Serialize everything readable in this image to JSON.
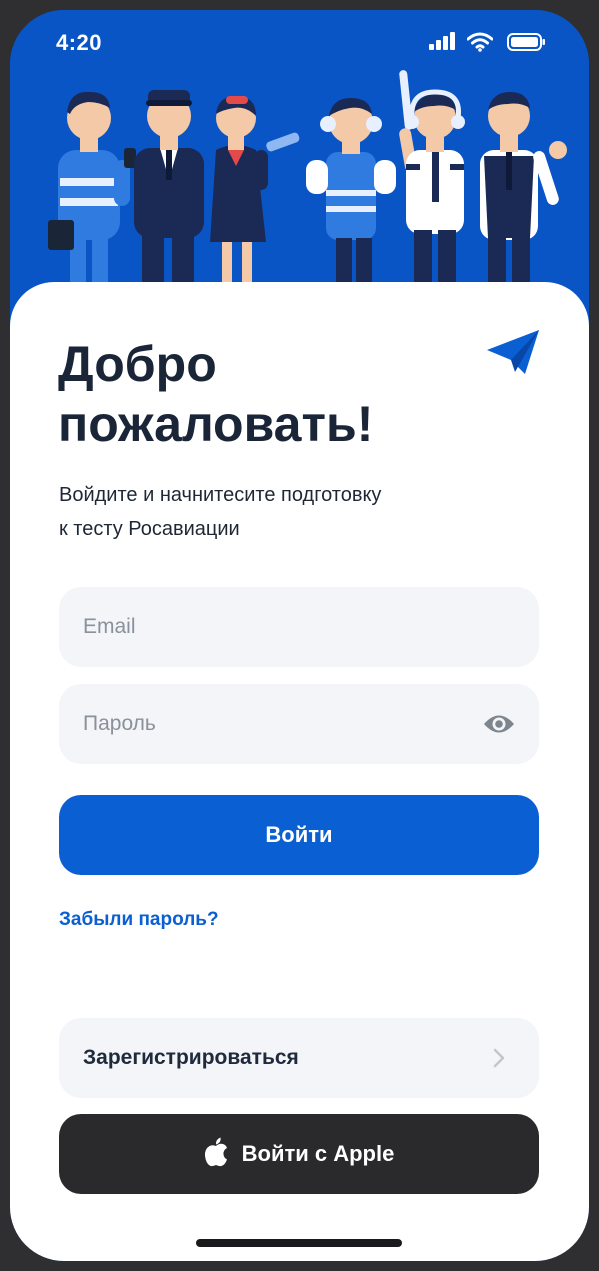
{
  "status_bar": {
    "time": "4:20",
    "icons": [
      "cellular-signal-icon",
      "wifi-icon",
      "battery-icon"
    ]
  },
  "hero": {
    "illustration": "aviation-crew-illustration",
    "background_color": "#0a55c6"
  },
  "login": {
    "title_line1": "Добро",
    "title_line2": "пожаловать!",
    "subtitle_line1": "Войдите и начнитесите подготовку",
    "subtitle_line2": "к тесту Росавиации",
    "email": {
      "placeholder": "Email",
      "value": ""
    },
    "password": {
      "placeholder": "Пароль",
      "value": ""
    },
    "submit_label": "Войти",
    "forgot_label": "Забыли пароль?",
    "register_label": "Зарегистрироваться",
    "apple_label": "Войти с Apple"
  },
  "colors": {
    "brand_blue": "#0a5fd3",
    "title": "#1a2537",
    "field_bg": "#f3f5f8",
    "apple_button": "#2a2a2c"
  }
}
